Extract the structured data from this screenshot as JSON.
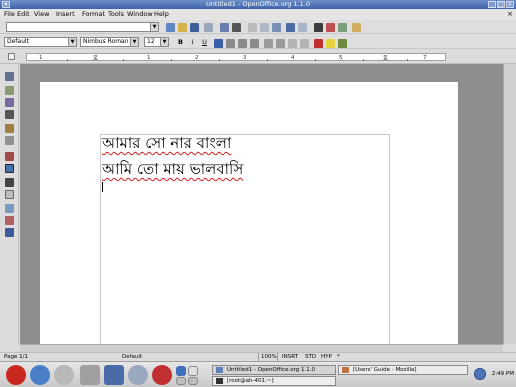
{
  "window": {
    "title": "Untitled1 - OpenOffice.org 1.1.0"
  },
  "menu": [
    "File",
    "Edit",
    "View",
    "Insert",
    "Format",
    "Tools",
    "Window",
    "Help"
  ],
  "format_toolbar": {
    "paragraph_style": "Default",
    "font_name": "Nimbus Roman N",
    "font_size": "12",
    "bold": "B",
    "italic": "i",
    "underline": "U"
  },
  "ruler": {
    "numbers": [
      "1",
      "1",
      "2",
      "3",
      "4",
      "5",
      "6",
      "7"
    ]
  },
  "document": {
    "lines": [
      "আমার সো   নার বাংলা",
      "আমি তো   মায় ভালবাসি"
    ]
  },
  "status": {
    "page": "Page 1/1",
    "style": "Default",
    "zoom": "100%",
    "insert": "INSRT",
    "selection": "STD",
    "hyperlink": "HYP",
    "modified": "*"
  },
  "taskbar": {
    "tasks": [
      "Untitled1 - OpenOffice.org 1.1.0",
      "[Users' Guide - Mozilla]",
      "[root@ah-401:~]"
    ],
    "clock": "2:49 PM"
  },
  "colors": {
    "titlebar": "#3c63ab",
    "spellcheck_underline": "#d02020",
    "workspace": "#8e8e8e"
  }
}
